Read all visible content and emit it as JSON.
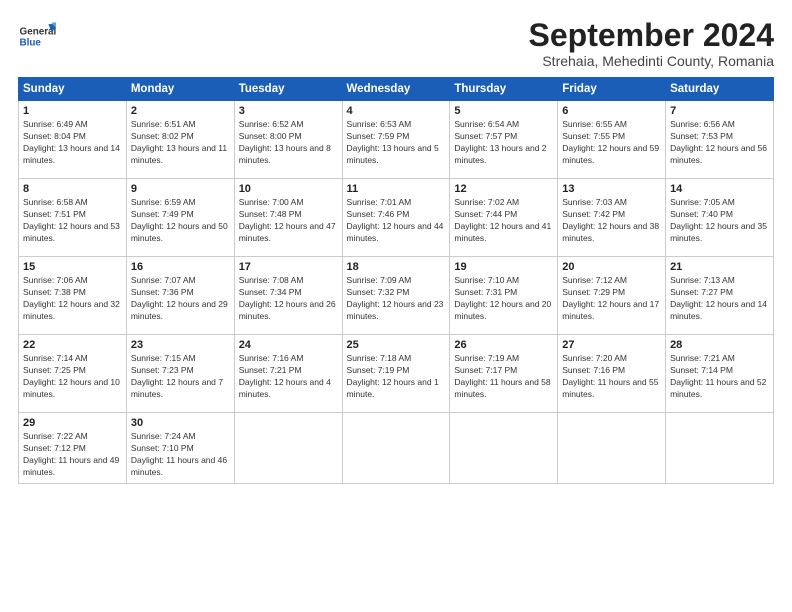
{
  "logo": {
    "general": "General",
    "blue": "Blue"
  },
  "title": "September 2024",
  "subtitle": "Strehaia, Mehedinti County, Romania",
  "weekdays": [
    "Sunday",
    "Monday",
    "Tuesday",
    "Wednesday",
    "Thursday",
    "Friday",
    "Saturday"
  ],
  "weeks": [
    [
      {
        "day": "1",
        "sunrise": "Sunrise: 6:49 AM",
        "sunset": "Sunset: 8:04 PM",
        "daylight": "Daylight: 13 hours and 14 minutes."
      },
      {
        "day": "2",
        "sunrise": "Sunrise: 6:51 AM",
        "sunset": "Sunset: 8:02 PM",
        "daylight": "Daylight: 13 hours and 11 minutes."
      },
      {
        "day": "3",
        "sunrise": "Sunrise: 6:52 AM",
        "sunset": "Sunset: 8:00 PM",
        "daylight": "Daylight: 13 hours and 8 minutes."
      },
      {
        "day": "4",
        "sunrise": "Sunrise: 6:53 AM",
        "sunset": "Sunset: 7:59 PM",
        "daylight": "Daylight: 13 hours and 5 minutes."
      },
      {
        "day": "5",
        "sunrise": "Sunrise: 6:54 AM",
        "sunset": "Sunset: 7:57 PM",
        "daylight": "Daylight: 13 hours and 2 minutes."
      },
      {
        "day": "6",
        "sunrise": "Sunrise: 6:55 AM",
        "sunset": "Sunset: 7:55 PM",
        "daylight": "Daylight: 12 hours and 59 minutes."
      },
      {
        "day": "7",
        "sunrise": "Sunrise: 6:56 AM",
        "sunset": "Sunset: 7:53 PM",
        "daylight": "Daylight: 12 hours and 56 minutes."
      }
    ],
    [
      {
        "day": "8",
        "sunrise": "Sunrise: 6:58 AM",
        "sunset": "Sunset: 7:51 PM",
        "daylight": "Daylight: 12 hours and 53 minutes."
      },
      {
        "day": "9",
        "sunrise": "Sunrise: 6:59 AM",
        "sunset": "Sunset: 7:49 PM",
        "daylight": "Daylight: 12 hours and 50 minutes."
      },
      {
        "day": "10",
        "sunrise": "Sunrise: 7:00 AM",
        "sunset": "Sunset: 7:48 PM",
        "daylight": "Daylight: 12 hours and 47 minutes."
      },
      {
        "day": "11",
        "sunrise": "Sunrise: 7:01 AM",
        "sunset": "Sunset: 7:46 PM",
        "daylight": "Daylight: 12 hours and 44 minutes."
      },
      {
        "day": "12",
        "sunrise": "Sunrise: 7:02 AM",
        "sunset": "Sunset: 7:44 PM",
        "daylight": "Daylight: 12 hours and 41 minutes."
      },
      {
        "day": "13",
        "sunrise": "Sunrise: 7:03 AM",
        "sunset": "Sunset: 7:42 PM",
        "daylight": "Daylight: 12 hours and 38 minutes."
      },
      {
        "day": "14",
        "sunrise": "Sunrise: 7:05 AM",
        "sunset": "Sunset: 7:40 PM",
        "daylight": "Daylight: 12 hours and 35 minutes."
      }
    ],
    [
      {
        "day": "15",
        "sunrise": "Sunrise: 7:06 AM",
        "sunset": "Sunset: 7:38 PM",
        "daylight": "Daylight: 12 hours and 32 minutes."
      },
      {
        "day": "16",
        "sunrise": "Sunrise: 7:07 AM",
        "sunset": "Sunset: 7:36 PM",
        "daylight": "Daylight: 12 hours and 29 minutes."
      },
      {
        "day": "17",
        "sunrise": "Sunrise: 7:08 AM",
        "sunset": "Sunset: 7:34 PM",
        "daylight": "Daylight: 12 hours and 26 minutes."
      },
      {
        "day": "18",
        "sunrise": "Sunrise: 7:09 AM",
        "sunset": "Sunset: 7:32 PM",
        "daylight": "Daylight: 12 hours and 23 minutes."
      },
      {
        "day": "19",
        "sunrise": "Sunrise: 7:10 AM",
        "sunset": "Sunset: 7:31 PM",
        "daylight": "Daylight: 12 hours and 20 minutes."
      },
      {
        "day": "20",
        "sunrise": "Sunrise: 7:12 AM",
        "sunset": "Sunset: 7:29 PM",
        "daylight": "Daylight: 12 hours and 17 minutes."
      },
      {
        "day": "21",
        "sunrise": "Sunrise: 7:13 AM",
        "sunset": "Sunset: 7:27 PM",
        "daylight": "Daylight: 12 hours and 14 minutes."
      }
    ],
    [
      {
        "day": "22",
        "sunrise": "Sunrise: 7:14 AM",
        "sunset": "Sunset: 7:25 PM",
        "daylight": "Daylight: 12 hours and 10 minutes."
      },
      {
        "day": "23",
        "sunrise": "Sunrise: 7:15 AM",
        "sunset": "Sunset: 7:23 PM",
        "daylight": "Daylight: 12 hours and 7 minutes."
      },
      {
        "day": "24",
        "sunrise": "Sunrise: 7:16 AM",
        "sunset": "Sunset: 7:21 PM",
        "daylight": "Daylight: 12 hours and 4 minutes."
      },
      {
        "day": "25",
        "sunrise": "Sunrise: 7:18 AM",
        "sunset": "Sunset: 7:19 PM",
        "daylight": "Daylight: 12 hours and 1 minute."
      },
      {
        "day": "26",
        "sunrise": "Sunrise: 7:19 AM",
        "sunset": "Sunset: 7:17 PM",
        "daylight": "Daylight: 11 hours and 58 minutes."
      },
      {
        "day": "27",
        "sunrise": "Sunrise: 7:20 AM",
        "sunset": "Sunset: 7:16 PM",
        "daylight": "Daylight: 11 hours and 55 minutes."
      },
      {
        "day": "28",
        "sunrise": "Sunrise: 7:21 AM",
        "sunset": "Sunset: 7:14 PM",
        "daylight": "Daylight: 11 hours and 52 minutes."
      }
    ],
    [
      {
        "day": "29",
        "sunrise": "Sunrise: 7:22 AM",
        "sunset": "Sunset: 7:12 PM",
        "daylight": "Daylight: 11 hours and 49 minutes."
      },
      {
        "day": "30",
        "sunrise": "Sunrise: 7:24 AM",
        "sunset": "Sunset: 7:10 PM",
        "daylight": "Daylight: 11 hours and 46 minutes."
      },
      null,
      null,
      null,
      null,
      null
    ]
  ]
}
